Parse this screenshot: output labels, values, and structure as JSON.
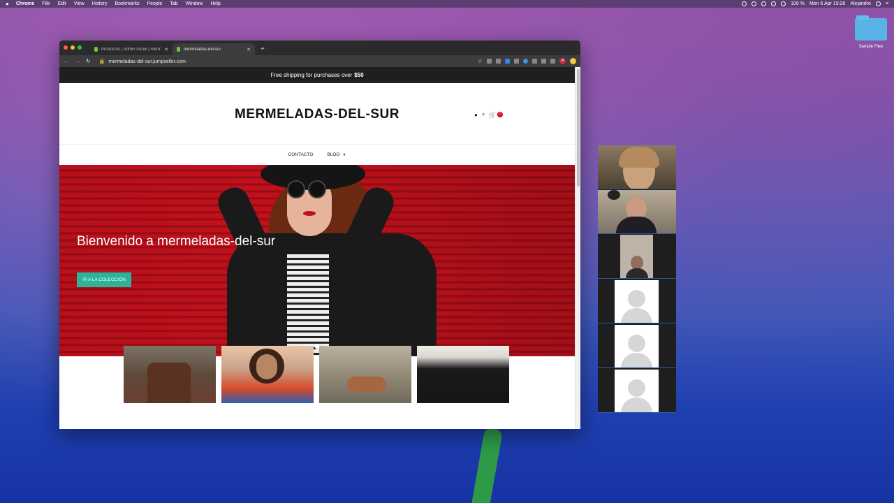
{
  "menubar": {
    "app": "Chrome",
    "items": [
      "File",
      "Edit",
      "View",
      "History",
      "Bookmarks",
      "People",
      "Tab",
      "Window",
      "Help"
    ],
    "battery": "100 %",
    "datetime": "Mon 6 Apr 19:26",
    "user": "Alejandro"
  },
  "desktop": {
    "folder_label": "Sample Files"
  },
  "browser": {
    "tabs": [
      {
        "title": "Productos | Admin Panel | merm",
        "active": false
      },
      {
        "title": "mermeladas-del-sur",
        "active": true
      }
    ],
    "url": "mermeladas-del-sur.jumpseller.com",
    "avatar_letter": "A"
  },
  "store": {
    "announcement_prefix": "Free shipping for purchases over",
    "announcement_amount": "$50",
    "logo": "MERMELADAS-DEL-SUR",
    "cart_count": "0",
    "nav": [
      {
        "label": "CONTACTO"
      },
      {
        "label": "BLOG"
      }
    ],
    "hero": {
      "title": "Bienvenido a mermeladas-del-sur",
      "button": "IR A LA COLECCIÓN",
      "slides": 3,
      "active_slide": 2
    }
  }
}
